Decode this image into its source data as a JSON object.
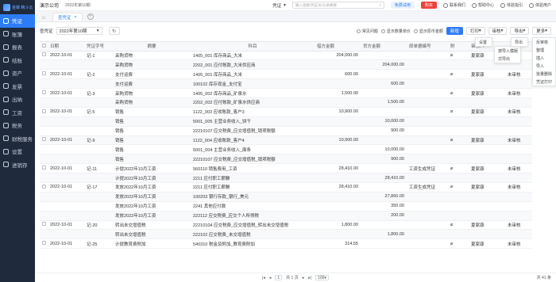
{
  "app": {
    "logo_text": "金蝶 精斗云",
    "company": "演示公司",
    "period": "2022年第10期"
  },
  "sidebar": {
    "items": [
      {
        "label": "凭证",
        "icon": "voucher-icon",
        "active": true
      },
      {
        "label": "账簿",
        "icon": "book-icon"
      },
      {
        "label": "报表",
        "icon": "report-icon"
      },
      {
        "label": "结账",
        "icon": "close-icon"
      },
      {
        "label": "资产",
        "icon": "asset-icon"
      },
      {
        "label": "发票",
        "icon": "invoice-icon"
      },
      {
        "label": "出纳",
        "icon": "cashier-icon"
      },
      {
        "label": "工资",
        "icon": "salary-icon"
      },
      {
        "label": "税务",
        "icon": "tax-icon"
      },
      {
        "label": "财税服务",
        "icon": "service-icon"
      },
      {
        "label": "设置",
        "icon": "settings-icon"
      },
      {
        "label": "进销存",
        "icon": "inventory-icon"
      }
    ]
  },
  "topbar": {
    "voucher_select": "凭证",
    "search_placeholder": "输入金额/凭证号/分录摘要",
    "free_label": "免费试用",
    "buy_label": "购买",
    "contact_label": "联系我们",
    "help_label": "帮助中心",
    "guide_label": "体验指引",
    "user_label": "体验用户"
  },
  "tabs": {
    "active": "查凭证"
  },
  "toolbar": {
    "label": "查凭证",
    "period": "2022年第10期",
    "common_query": "常见问题",
    "show_qty": "显示数量单价",
    "show_fx": "显示原币金额",
    "new_label": "新增",
    "print_label": "打印",
    "audit_label": "审核",
    "export_label": "导出",
    "more_label": "更多"
  },
  "dropdowns": {
    "print_menu": [
      "设置"
    ],
    "audit_menu": [
      "按导入模版",
      "式导出"
    ],
    "export_menu": [
      "导出"
    ],
    "more_menu": [
      "反审核",
      "整理",
      "插入",
      "导入",
      "批量删除",
      "凭证打印"
    ]
  },
  "table": {
    "headers": [
      "日期",
      "凭证字号",
      "摘要",
      "科目",
      "借方金额",
      "贷方金额",
      "原单据编号",
      "附",
      "",
      "审核人"
    ],
    "rows": [
      {
        "date": "2022-10-01",
        "no": "记-1",
        "summary": "采购货物",
        "subject": "1405_001 库存商品_大米",
        "debit": "204,000.00",
        "credit": "",
        "src": "",
        "att": true,
        "auditor": "夏家康",
        "status": "已审核"
      },
      {
        "date": "",
        "no": "",
        "summary": "采购货物",
        "subject": "2202_001 应付账款_大米供应商",
        "debit": "",
        "credit": "204,000.00",
        "src": "",
        "att": false,
        "auditor": "",
        "status": ""
      },
      {
        "date": "2022-10-01",
        "no": "记-2",
        "summary": "支付运费",
        "subject": "1405_001 库存商品_大米",
        "debit": "600.00",
        "credit": "",
        "src": "",
        "att": true,
        "auditor": "夏家康",
        "status": "未审核"
      },
      {
        "date": "",
        "no": "",
        "summary": "支付运费",
        "subject": "100102 库存现金_支付宝",
        "debit": "",
        "credit": "600.00",
        "src": "",
        "att": false,
        "auditor": "",
        "status": ""
      },
      {
        "date": "2022-10-01",
        "no": "记-3",
        "summary": "采购货物",
        "subject": "1405_002 库存商品_矿泉水",
        "debit": "1,500.00",
        "credit": "",
        "src": "",
        "att": true,
        "auditor": "夏家康",
        "status": "未审核"
      },
      {
        "date": "",
        "no": "",
        "summary": "采购货物",
        "subject": "2202_002 应付账款_矿泉水供应商",
        "debit": "",
        "credit": "1,500.00",
        "src": "",
        "att": false,
        "auditor": "",
        "status": ""
      },
      {
        "date": "2022-10-01",
        "no": "记-5",
        "summary": "销售",
        "subject": "1122_003 应收账款_客户3",
        "debit": "10,900.00",
        "credit": "",
        "src": "",
        "att": true,
        "auditor": "夏家康",
        "status": "未审核"
      },
      {
        "date": "",
        "no": "",
        "summary": "销售",
        "subject": "5001_005 主营业务收入_饼干",
        "debit": "",
        "credit": "10,000.00",
        "src": "",
        "att": false,
        "auditor": "",
        "status": ""
      },
      {
        "date": "",
        "no": "",
        "summary": "销售",
        "subject": "22210107 应交税费_应交增值税_销项税额",
        "debit": "",
        "credit": "900.00",
        "src": "",
        "att": false,
        "auditor": "",
        "status": ""
      },
      {
        "date": "2022-10-01",
        "no": "记-9",
        "summary": "销售",
        "subject": "1122_004 应收账款_客户4",
        "debit": "10,900.00",
        "credit": "",
        "src": "",
        "att": true,
        "auditor": "夏家康",
        "status": "未审核"
      },
      {
        "date": "",
        "no": "",
        "summary": "销售",
        "subject": "5001_004 主营业务收入_面条",
        "debit": "",
        "credit": "10,000.00",
        "src": "",
        "att": false,
        "auditor": "",
        "status": ""
      },
      {
        "date": "",
        "no": "",
        "summary": "销售",
        "subject": "22210107 应交税费_应交增值税_销项税额",
        "debit": "",
        "credit": "900.00",
        "src": "",
        "att": false,
        "auditor": "",
        "status": ""
      },
      {
        "date": "2022-10-01",
        "no": "记-11",
        "summary": "计提2022年10月工资",
        "subject": "560110 销售费用_工资",
        "debit": "28,410.00",
        "credit": "",
        "src": "工资生成凭证",
        "att": true,
        "auditor": "夏家康",
        "status": "未审核"
      },
      {
        "date": "",
        "no": "",
        "summary": "计提2022年10月工资",
        "subject": "2211 应付职工薪酬",
        "debit": "",
        "credit": "28,410.00",
        "src": "",
        "att": false,
        "auditor": "",
        "status": ""
      },
      {
        "date": "2022-10-01",
        "no": "记-17",
        "summary": "发放2022年10月工资",
        "subject": "2211 应付职工薪酬",
        "debit": "28,410.00",
        "credit": "",
        "src": "工资生成凭证",
        "att": true,
        "auditor": "夏家康",
        "status": "未审核"
      },
      {
        "date": "",
        "no": "",
        "summary": "发放2022年10月工资",
        "subject": "100203 银行存款_银行_美元",
        "debit": "",
        "credit": "27,860.00",
        "src": "",
        "att": false,
        "auditor": "",
        "status": ""
      },
      {
        "date": "",
        "no": "",
        "summary": "发放2022年10月工资",
        "subject": "2241 其他应付款",
        "debit": "",
        "credit": "350.00",
        "src": "",
        "att": false,
        "auditor": "",
        "status": ""
      },
      {
        "date": "",
        "no": "",
        "summary": "发放2022年10月工资",
        "subject": "222112 应交税费_应交个人所得税",
        "debit": "",
        "credit": "200.00",
        "src": "",
        "att": false,
        "auditor": "",
        "status": ""
      },
      {
        "date": "2022-10-01",
        "no": "记-20",
        "summary": "转出未交增值税",
        "subject": "22210104 应交税费_应交增值税_转出未交增值税",
        "debit": "1,800.00",
        "credit": "",
        "src": "",
        "att": true,
        "auditor": "夏家康",
        "status": "未审核"
      },
      {
        "date": "",
        "no": "",
        "summary": "转出未交增值税",
        "subject": "222102 应交税费_未交增值税",
        "debit": "",
        "credit": "1,800.00",
        "src": "",
        "att": false,
        "auditor": "",
        "status": ""
      },
      {
        "date": "2022-10-01",
        "no": "记-25",
        "summary": "计提教育费附加",
        "subject": "540310 税金及附加_教育费附加",
        "debit": "314.55",
        "credit": "",
        "src": "",
        "att": true,
        "auditor": "夏家康",
        "status": "未审核"
      }
    ]
  },
  "pager": {
    "page": "1",
    "of": "共 1 页",
    "size": "100",
    "total": "共 41 条"
  }
}
